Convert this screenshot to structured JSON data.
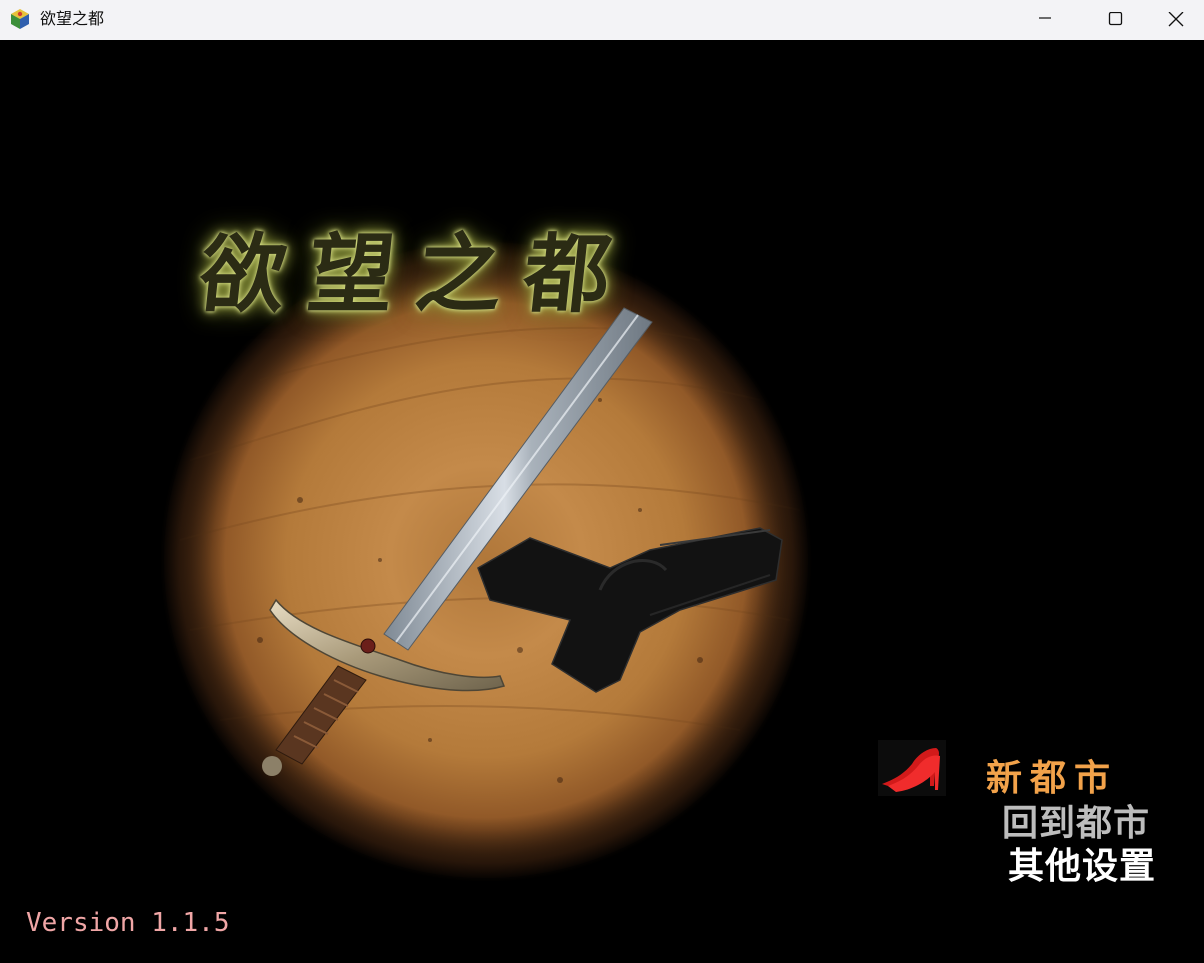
{
  "window": {
    "title": "欲望之都",
    "app_icon": "rpg-maker-cube-icon",
    "controls": [
      "minimize-icon",
      "maximize-icon",
      "close-icon"
    ]
  },
  "game": {
    "logo_text": "欲望之都",
    "emblem": "sword-and-pistol-on-wood-slice",
    "menu": {
      "cursor_icon": "red-high-heel-icon",
      "selected_index": 0,
      "items": [
        {
          "label": "新都市",
          "color": "#f2a24a"
        },
        {
          "label": "回到都市",
          "color": "#bdbdbd"
        },
        {
          "label": "其他设置",
          "color": "#ffffff"
        }
      ]
    },
    "version": "Version 1.1.5"
  },
  "colors": {
    "background": "#000000",
    "titlebar": "#f3f3f6",
    "version_text": "#f0a6a6",
    "logo_glow": "#a7b04a"
  }
}
